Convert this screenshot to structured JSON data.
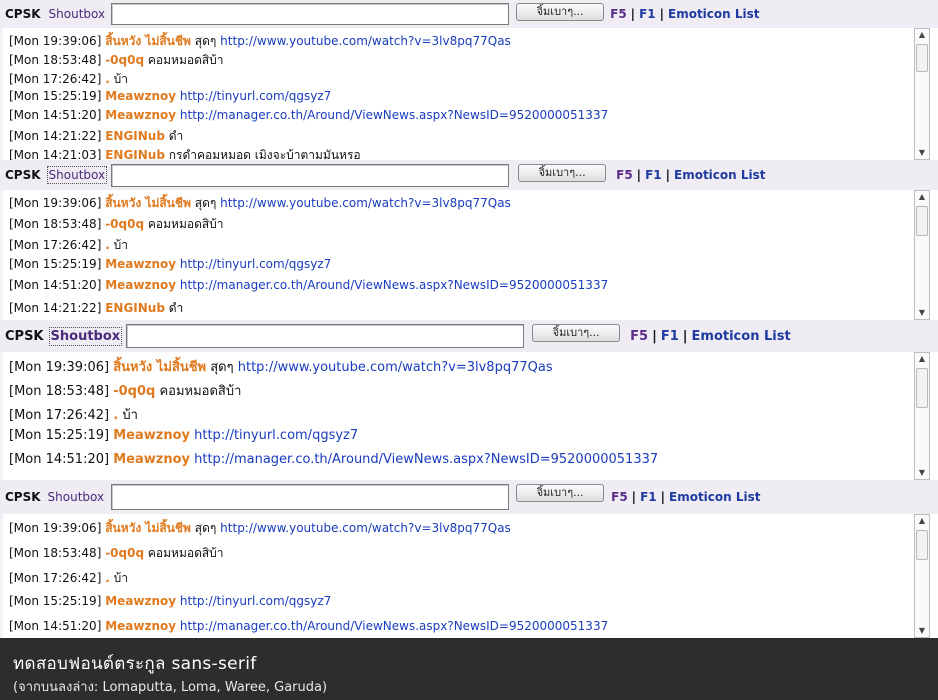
{
  "bar": {
    "cpsk": "CPSK",
    "shoutbox": "Shoutbox",
    "input_value": "",
    "button_label": "จิ้มเบาๆ...",
    "f5": "F5",
    "f1": "F1",
    "emoticon": "Emoticon  List",
    "separator": "|"
  },
  "rows": [
    {
      "ts": "[Mon 19:39:06]",
      "name": "สิ้นหวัง ไม่สิ้นชีพ",
      "msg": "สุดๆ",
      "link": "http://www.youtube.com/watch?v=3lv8pq77Qas"
    },
    {
      "ts": "[Mon 18:53:48]",
      "name": "-0q0q",
      "msg": "คอมหมอดสิบ้า",
      "link": ""
    },
    {
      "ts": "[Mon 17:26:42]",
      "name": ".",
      "msg": "บ้า",
      "link": ""
    },
    {
      "ts": "[Mon 15:25:19]",
      "name": "Meawznoy",
      "msg": "",
      "link": "http://tinyurl.com/qgsyz7"
    },
    {
      "ts": "[Mon 14:51:20]",
      "name": "Meawznoy",
      "msg": "",
      "link": "http://manager.co.th/Around/ViewNews.aspx?NewsID=9520000051337"
    },
    {
      "ts": "[Mon 14:21:22]",
      "name": "ENGINub",
      "msg": "ดำ",
      "link": ""
    },
    {
      "ts": "[Mon 14:21:03]",
      "name": "ENGINub",
      "msg": "กรดำคอมหมอด เมิงจะบ้าตามมันหรอ",
      "link": ""
    }
  ],
  "footer": {
    "title": "ทดสอบฟอนต์ตระกูล sans-serif",
    "subtitle": "(จากบนลงล่าง: Lomaputta, Loma, Waree, Garuda)"
  },
  "colors": {
    "name": "#e07a1f",
    "link": "#1a3cbe",
    "bar_bg": "#efedf3",
    "footer_bg": "#2d2d2d"
  }
}
